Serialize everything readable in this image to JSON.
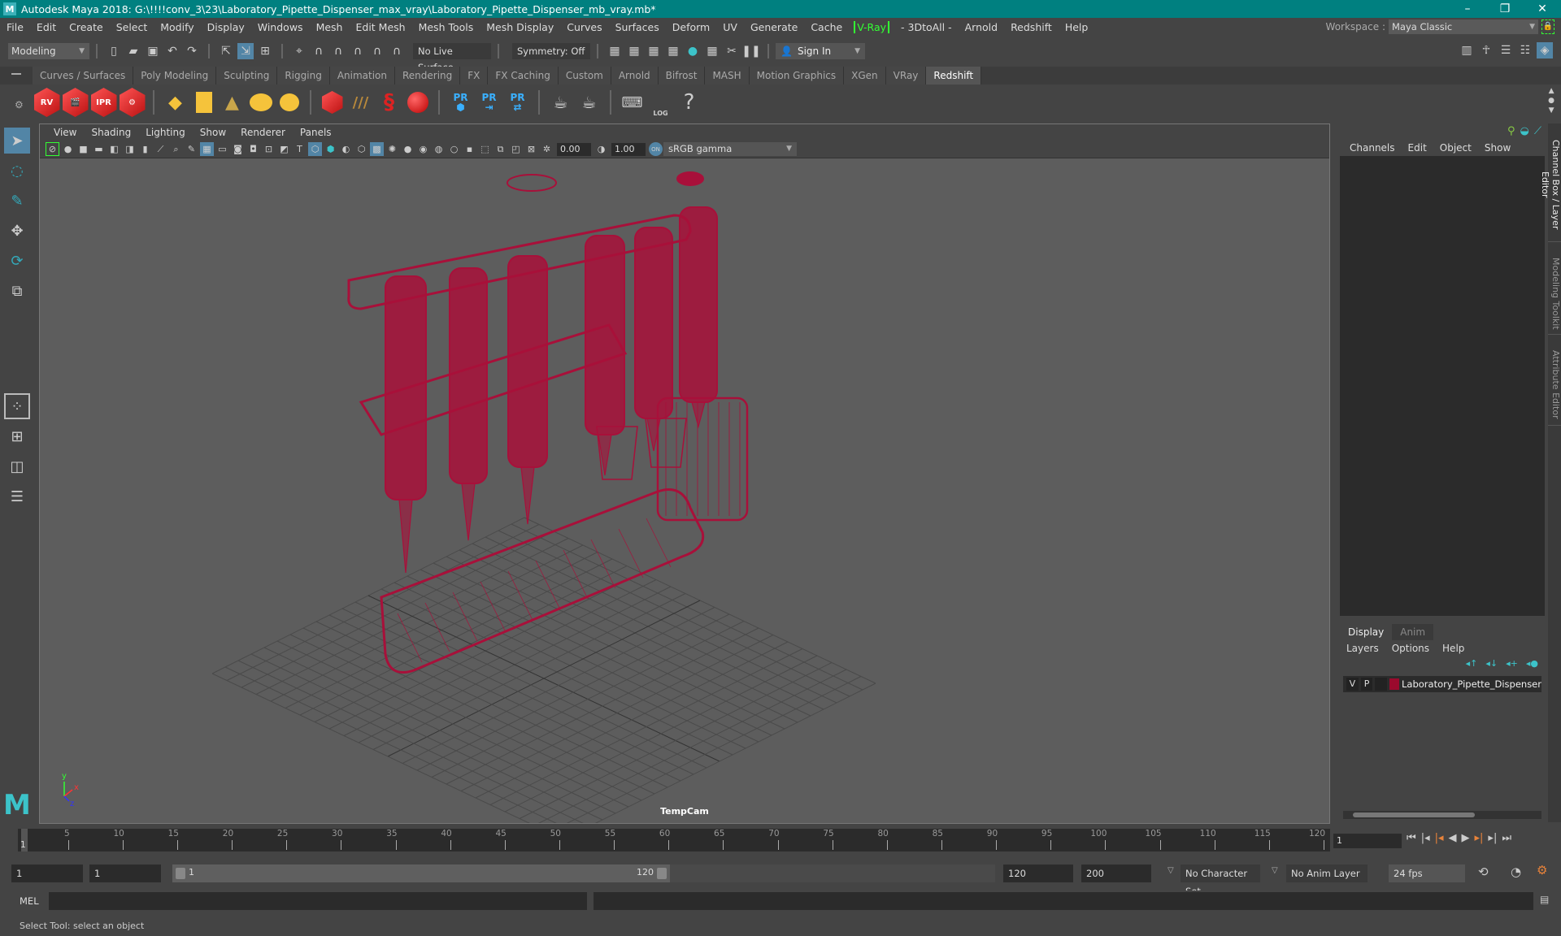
{
  "window": {
    "title": "Autodesk Maya 2018: G:\\!!!!conv_3\\23\\Laboratory_Pipette_Dispenser_max_vray\\Laboratory_Pipette_Dispenser_mb_vray.mb*",
    "logo": "M",
    "controls": [
      "–",
      "❐",
      "✕"
    ]
  },
  "menubar": {
    "items": [
      "File",
      "Edit",
      "Create",
      "Select",
      "Modify",
      "Display",
      "Windows",
      "Mesh",
      "Edit Mesh",
      "Mesh Tools",
      "Mesh Display",
      "Curves",
      "Surfaces",
      "Deform",
      "UV",
      "Generate",
      "Cache"
    ],
    "vray": "V-Ray",
    "items2": [
      "- 3DtoAll -",
      "Arnold",
      "Redshift",
      "Help"
    ],
    "workspace_label": "Workspace :",
    "workspace_value": "Maya Classic"
  },
  "statusline": {
    "mode": "Modeling",
    "live_surface": "No Live Surface",
    "symmetry": "Symmetry: Off",
    "sign_in": "Sign In"
  },
  "shelf": {
    "tabs": [
      "Curves / Surfaces",
      "Poly Modeling",
      "Sculpting",
      "Rigging",
      "Animation",
      "Rendering",
      "FX",
      "FX Caching",
      "Custom",
      "Arnold",
      "Bifrost",
      "MASH",
      "Motion Graphics",
      "XGen",
      "VRay",
      "Redshift"
    ],
    "active_tab": "Redshift",
    "icons": {
      "rv": "RV",
      "ipr": "IPR",
      "pr1": "PR",
      "pr2": "PR",
      "pr3": "PR",
      "log": "LOG",
      "help": "?"
    }
  },
  "viewport": {
    "menu": [
      "View",
      "Shading",
      "Lighting",
      "Show",
      "Renderer",
      "Panels"
    ],
    "exposure": "0.00",
    "gamma": "1.00",
    "color_space": "sRGB gamma",
    "camera": "TempCam",
    "axis": {
      "x": "x",
      "y": "y",
      "z": "z"
    },
    "wire_color": "#a8103a"
  },
  "channelbox": {
    "menu": [
      "Channels",
      "Edit",
      "Object",
      "Show"
    ]
  },
  "layer_editor": {
    "tabs": [
      "Display",
      "Anim"
    ],
    "menu": [
      "Layers",
      "Options",
      "Help"
    ],
    "layers": [
      {
        "v": "V",
        "p": "P",
        "color": "#9b0a2d",
        "name": "Laboratory_Pipette_Dispenser"
      }
    ]
  },
  "side_tabs": [
    "Channel Box / Layer Editor",
    "Modeling Toolkit",
    "Attribute Editor"
  ],
  "timeline": {
    "ticks": [
      5,
      10,
      15,
      20,
      25,
      30,
      35,
      40,
      45,
      50,
      55,
      60,
      65,
      70,
      75,
      80,
      85,
      90,
      95,
      100,
      105,
      110,
      115,
      120
    ],
    "start": 1,
    "end": 120,
    "current_frame": "1",
    "current_marker": "1"
  },
  "range": {
    "start_field": "1",
    "playback_start": "1",
    "slider_start": "1",
    "slider_end": "120",
    "playback_end": "120",
    "end_field": "200",
    "character_set": "No Character Set",
    "anim_layer": "No Anim Layer",
    "fps": "24 fps"
  },
  "cmdline": {
    "label": "MEL"
  },
  "status": {
    "help_text": "Select Tool: select an object"
  }
}
